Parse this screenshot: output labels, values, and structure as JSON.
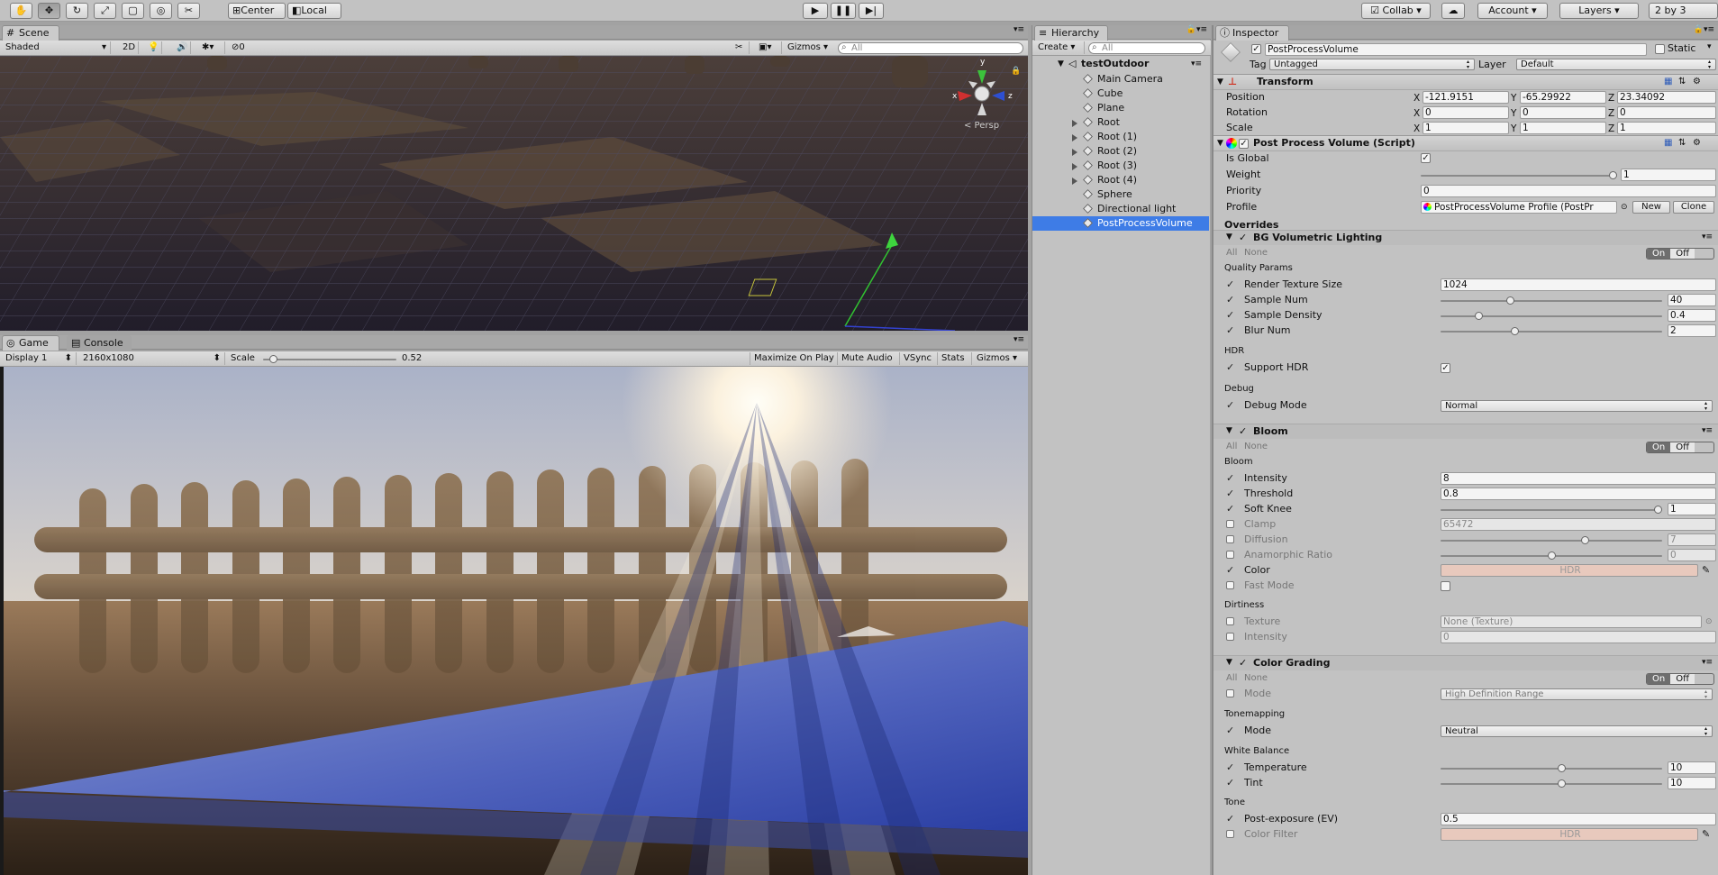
{
  "toolbar": {
    "pivot": "Center",
    "space": "Local",
    "collab": "Collab ▾",
    "account": "Account",
    "layers": "Layers",
    "layout": "2 by 3"
  },
  "scene": {
    "tab": "Scene",
    "shading": "Shaded",
    "mode2d": "2D",
    "fx_count": "0",
    "gizmos": "Gizmos",
    "search_placeholder": "All",
    "persp": "< Persp",
    "axis_x": "x",
    "axis_y": "y",
    "axis_z": "z"
  },
  "game": {
    "tab_game": "Game",
    "tab_console": "Console",
    "display": "Display 1",
    "resolution": "2160x1080",
    "scale_label": "Scale",
    "scale_value": "0.52",
    "scale_fraction": 0.05,
    "maximize": "Maximize On Play",
    "mute": "Mute Audio",
    "vsync": "VSync",
    "stats": "Stats",
    "gizmos": "Gizmos"
  },
  "hierarchy": {
    "tab": "Hierarchy",
    "create": "Create",
    "search_placeholder": "All",
    "scene_name": "testOutdoor",
    "items": [
      {
        "label": "Main Camera",
        "expandable": false
      },
      {
        "label": "Cube",
        "expandable": false
      },
      {
        "label": "Plane",
        "expandable": false
      },
      {
        "label": "Root",
        "expandable": true
      },
      {
        "label": "Root (1)",
        "expandable": true
      },
      {
        "label": "Root (2)",
        "expandable": true
      },
      {
        "label": "Root (3)",
        "expandable": true
      },
      {
        "label": "Root (4)",
        "expandable": true
      },
      {
        "label": "Sphere",
        "expandable": false
      },
      {
        "label": "Directional light",
        "expandable": false
      },
      {
        "label": "PostProcessVolume",
        "expandable": false,
        "selected": true
      }
    ]
  },
  "inspector": {
    "tab": "Inspector",
    "object_name": "PostProcessVolume",
    "static_label": "Static",
    "tag_label": "Tag",
    "tag_value": "Untagged",
    "layer_label": "Layer",
    "layer_value": "Default",
    "transform": {
      "title": "Transform",
      "position_label": "Position",
      "rotation_label": "Rotation",
      "scale_label": "Scale",
      "position": [
        "-121.9151",
        "-65.29922",
        "23.34092"
      ],
      "rotation": [
        "0",
        "0",
        "0"
      ],
      "scale": [
        "1",
        "1",
        "1"
      ],
      "x": "X",
      "y": "Y",
      "z": "Z"
    },
    "ppv": {
      "title": "Post Process Volume (Script)",
      "is_global": "Is Global",
      "weight": "Weight",
      "weight_value": "1",
      "weight_fraction": 1.0,
      "priority": "Priority",
      "priority_value": "0",
      "profile": "Profile",
      "profile_value": "PostProcessVolume Profile (PostPr",
      "new": "New",
      "clone": "Clone",
      "overrides": "Overrides",
      "all": "All",
      "none": "None",
      "on": "On",
      "off": "Off"
    },
    "bgvl": {
      "title": "BG Volumetric Lighting",
      "quality": "Quality Params",
      "rts_label": "Render Texture Size",
      "rts_value": "1024",
      "sample_num_label": "Sample Num",
      "sample_num_value": "40",
      "sample_num_fraction": 0.31,
      "sample_density_label": "Sample Density",
      "sample_density_value": "0.4",
      "sample_density_fraction": 0.16,
      "blur_num_label": "Blur Num",
      "blur_num_value": "2",
      "blur_num_fraction": 0.33,
      "hdr": "HDR",
      "support_hdr": "Support HDR",
      "debug": "Debug",
      "debug_mode": "Debug Mode",
      "debug_mode_value": "Normal"
    },
    "bloom": {
      "title": "Bloom",
      "section": "Bloom",
      "intensity_label": "Intensity",
      "intensity_value": "8",
      "threshold_label": "Threshold",
      "threshold_value": "0.8",
      "soft_knee_label": "Soft Knee",
      "soft_knee_value": "1",
      "soft_knee_fraction": 1.0,
      "clamp_label": "Clamp",
      "clamp_value": "65472",
      "diffusion_label": "Diffusion",
      "diffusion_value": "7",
      "diffusion_fraction": 0.66,
      "anamorphic_label": "Anamorphic Ratio",
      "anamorphic_value": "0",
      "anamorphic_fraction": 0.5,
      "color_label": "Color",
      "color_value": "HDR",
      "color_hex": "#e8c9bd",
      "fast_mode": "Fast Mode",
      "dirtiness": "Dirtiness",
      "texture_label": "Texture",
      "texture_value": "None (Texture)",
      "dirt_intensity_label": "Intensity",
      "dirt_intensity_value": "0"
    },
    "grading": {
      "title": "Color Grading",
      "mode_label": "Mode",
      "mode_value": "High Definition Range",
      "tonemapping": "Tonemapping",
      "tm_mode_label": "Mode",
      "tm_mode_value": "Neutral",
      "white_balance": "White Balance",
      "temperature_label": "Temperature",
      "temperature_value": "10",
      "temperature_fraction": 0.55,
      "tint_label": "Tint",
      "tint_value": "10",
      "tint_fraction": 0.55,
      "tone": "Tone",
      "post_exposure_label": "Post-exposure (EV)",
      "post_exposure_value": "0.5",
      "color_filter_label": "Color Filter",
      "color_filter_value": "HDR"
    }
  },
  "colors": {
    "selection": "#3e7ce6",
    "inspector_bg": "#c2c2c2",
    "panel_header": "#a5a5a5"
  }
}
